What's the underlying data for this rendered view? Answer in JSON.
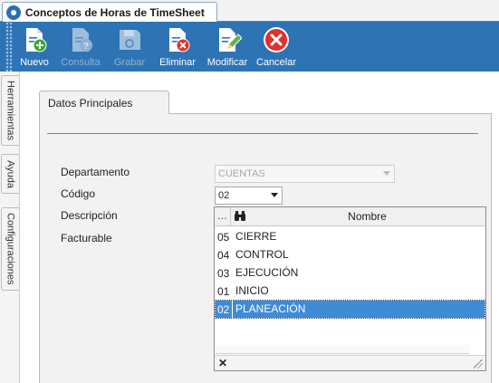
{
  "window": {
    "title": "Conceptos de Horas de TimeSheet"
  },
  "toolbar": {
    "buttons": [
      {
        "label": "Nuevo",
        "icon": "new-document-icon",
        "enabled": true
      },
      {
        "label": "Consulta",
        "icon": "query-document-icon",
        "enabled": false
      },
      {
        "label": "Grabar",
        "icon": "save-disk-icon",
        "enabled": false
      },
      {
        "label": "Eliminar",
        "icon": "delete-document-icon",
        "enabled": true
      },
      {
        "label": "Modificar",
        "icon": "edit-document-icon",
        "enabled": true
      },
      {
        "label": "Cancelar",
        "icon": "cancel-circle-icon",
        "enabled": true
      }
    ],
    "colors": {
      "background": "#2e74b5",
      "add": "#3aa935",
      "delete": "#e0302d"
    }
  },
  "sidebar": {
    "tabs": [
      {
        "label": "Herramientas"
      },
      {
        "label": "Ayuda"
      },
      {
        "label": "Configuraciones"
      }
    ]
  },
  "panel": {
    "tab_label": "Datos Principales",
    "fields": {
      "departamento": {
        "label": "Departamento",
        "value": "CUENTAS",
        "enabled": false
      },
      "codigo": {
        "label": "Código",
        "value": "02"
      },
      "descripcion": {
        "label": "Descripción"
      },
      "facturable": {
        "label": "Facturable"
      }
    }
  },
  "dropdown": {
    "header": {
      "col1": "…",
      "icon": "binoculars-icon",
      "col2": "Nombre"
    },
    "rows": [
      {
        "code": "05",
        "name": "CIERRE"
      },
      {
        "code": "04",
        "name": "CONTROL"
      },
      {
        "code": "03",
        "name": "EJECUCIÓN"
      },
      {
        "code": "01",
        "name": "INICIO"
      },
      {
        "code": "02",
        "name": "PLANEACIÓN"
      }
    ],
    "selected_code": "02",
    "footer": {
      "close": "✕"
    },
    "selection_color": "#3f8bd6"
  }
}
